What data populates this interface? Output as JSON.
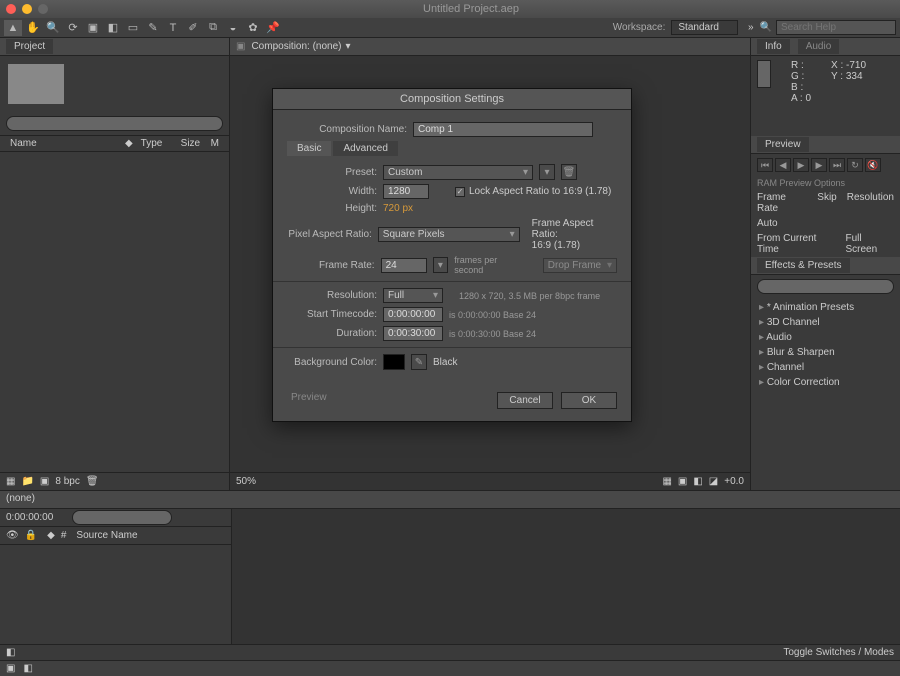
{
  "title": "Untitled Project.aep",
  "toolbar": {
    "workspace_label": "Workspace:",
    "workspace_value": "Standard",
    "search_placeholder": "Search Help"
  },
  "project": {
    "tab": "Project",
    "search_placeholder": "",
    "columns": {
      "name": "Name",
      "type": "Type",
      "size": "Size",
      "m": "M"
    },
    "footer_bpc": "8 bpc"
  },
  "composition_panel": {
    "label": "Composition: (none)"
  },
  "info": {
    "tab_info": "Info",
    "tab_audio": "Audio",
    "r": "R :",
    "g": "G :",
    "b": "B :",
    "a": "A : 0",
    "x": "X : -710",
    "y": "Y : 334"
  },
  "preview": {
    "tab": "Preview",
    "ram_options": "RAM Preview Options",
    "frame_rate": "Frame Rate",
    "skip": "Skip",
    "resolution": "Resolution",
    "auto": "Auto",
    "from_current": "From Current Time",
    "full_screen": "Full Screen"
  },
  "effects": {
    "tab": "Effects & Presets",
    "items": [
      "* Animation Presets",
      "3D Channel",
      "Audio",
      "Blur & Sharpen",
      "Channel",
      "Color Correction"
    ]
  },
  "timeline": {
    "tab": "(none)",
    "zoom": "50%",
    "plus": "+0.0",
    "timecode": "0:00:00:00",
    "source_col": "Source Name",
    "toggle": "Toggle Switches / Modes"
  },
  "dialog": {
    "title": "Composition Settings",
    "name_label": "Composition Name:",
    "name_value": "Comp 1",
    "tab_basic": "Basic",
    "tab_advanced": "Advanced",
    "preset_label": "Preset:",
    "preset_value": "Custom",
    "width_label": "Width:",
    "width_value": "1280",
    "height_label": "Height:",
    "height_value": "720 px",
    "lock_ar": "Lock Aspect Ratio to 16:9 (1.78)",
    "par_label": "Pixel Aspect Ratio:",
    "par_value": "Square Pixels",
    "frame_ar_label": "Frame Aspect Ratio:",
    "frame_ar_value": "16:9 (1.78)",
    "fr_label": "Frame Rate:",
    "fr_value": "24",
    "fr_unit": "frames per second",
    "drop_frame": "Drop Frame",
    "res_label": "Resolution:",
    "res_value": "Full",
    "res_info": "1280 x 720, 3.5 MB per 8bpc frame",
    "stc_label": "Start Timecode:",
    "stc_value": "0:00:00:00",
    "stc_info": "is 0:00:00:00  Base 24",
    "dur_label": "Duration:",
    "dur_value": "0:00:30:00",
    "dur_info": "is 0:00:30:00  Base 24",
    "bg_label": "Background Color:",
    "bg_name": "Black",
    "preview": "Preview",
    "cancel": "Cancel",
    "ok": "OK"
  }
}
